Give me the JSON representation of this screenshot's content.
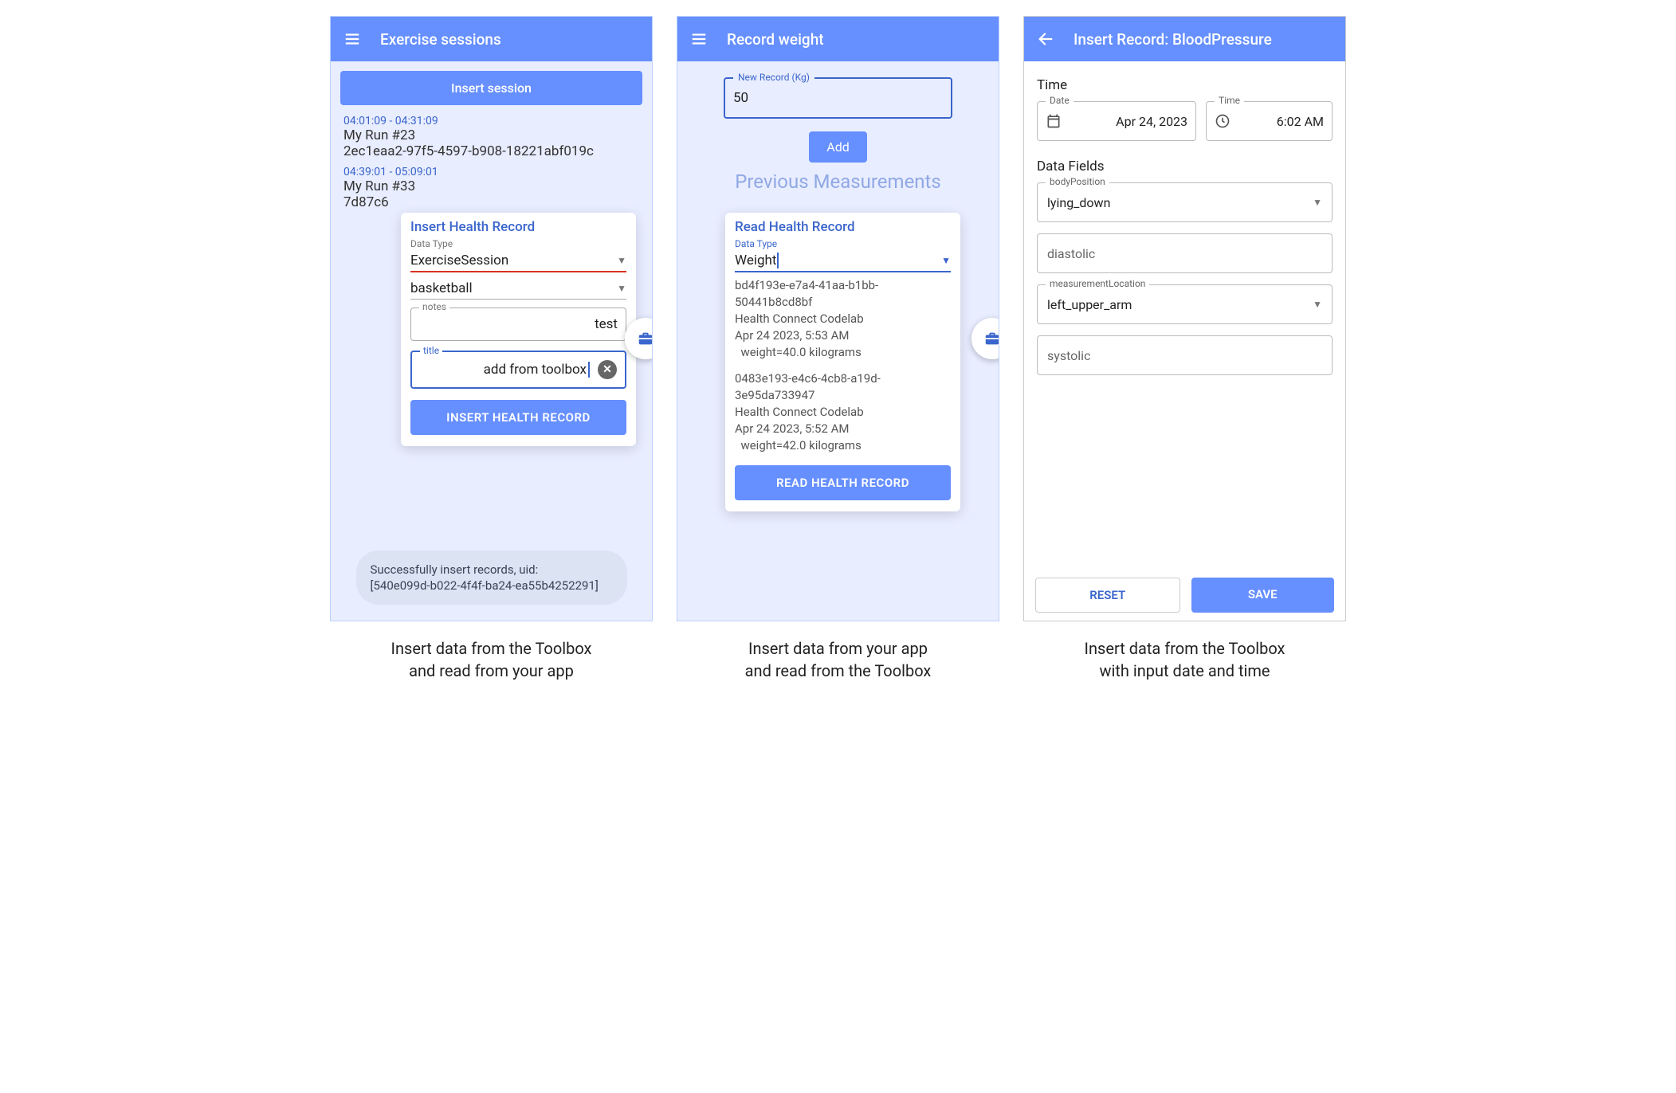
{
  "screen1": {
    "title": "Exercise sessions",
    "insert_session_btn": "Insert session",
    "runs": [
      {
        "time": "04:01:09 - 04:31:09",
        "name": "My Run #23",
        "uuid": "2ec1eaa2-97f5-4597-b908-18221abf019c"
      },
      {
        "time": "04:39:01 - 05:09:01",
        "name": "My Run #33",
        "uuid": "7d87c6"
      }
    ],
    "dialog": {
      "title": "Insert Health Record",
      "data_type_label": "Data Type",
      "data_type_value": "ExerciseSession",
      "exercise_type_value": "basketball",
      "notes_label": "notes",
      "notes_value": "test",
      "title_label": "title",
      "title_value": "add from toolbox",
      "button": "INSERT HEALTH RECORD"
    },
    "toast_line1": "Successfully insert records, uid:",
    "toast_line2": "[540e099d-b022-4f4f-ba24-ea55b4252291]"
  },
  "screen2": {
    "title": "Record weight",
    "new_record_label": "New Record (Kg)",
    "new_record_value": "50",
    "add_btn": "Add",
    "previous_heading": "Previous Measurements",
    "dialog": {
      "title": "Read Health Record",
      "data_type_label": "Data Type",
      "data_type_value": "Weight",
      "records": [
        {
          "uuid": "bd4f193e-e7a4-41aa-b1bb-50441b8cd8bf",
          "app": "Health Connect Codelab",
          "ts": "Apr 24 2023, 5:53 AM",
          "val": "  weight=40.0 kilograms"
        },
        {
          "uuid": "0483e193-e4c6-4cb8-a19d-3e95da733947",
          "app": "Health Connect Codelab",
          "ts": "Apr 24 2023, 5:52 AM",
          "val": "  weight=42.0 kilograms"
        }
      ],
      "button": "READ HEALTH RECORD"
    }
  },
  "screen3": {
    "title": "Insert Record: BloodPressure",
    "time_heading": "Time",
    "date_label": "Date",
    "date_value": "Apr 24, 2023",
    "time_label": "Time",
    "time_value": "6:02 AM",
    "data_fields_heading": "Data Fields",
    "body_position_label": "bodyPosition",
    "body_position_value": "lying_down",
    "diastolic_label": "diastolic",
    "measurement_location_label": "measurementLocation",
    "measurement_location_value": "left_upper_arm",
    "systolic_label": "systolic",
    "reset_btn": "RESET",
    "save_btn": "SAVE"
  },
  "captions": {
    "c1a": "Insert data from the Toolbox",
    "c1b": "and read from your app",
    "c2a": "Insert data from your app",
    "c2b": "and read from the Toolbox",
    "c3a": "Insert data from the Toolbox",
    "c3b": "with input date and time"
  }
}
